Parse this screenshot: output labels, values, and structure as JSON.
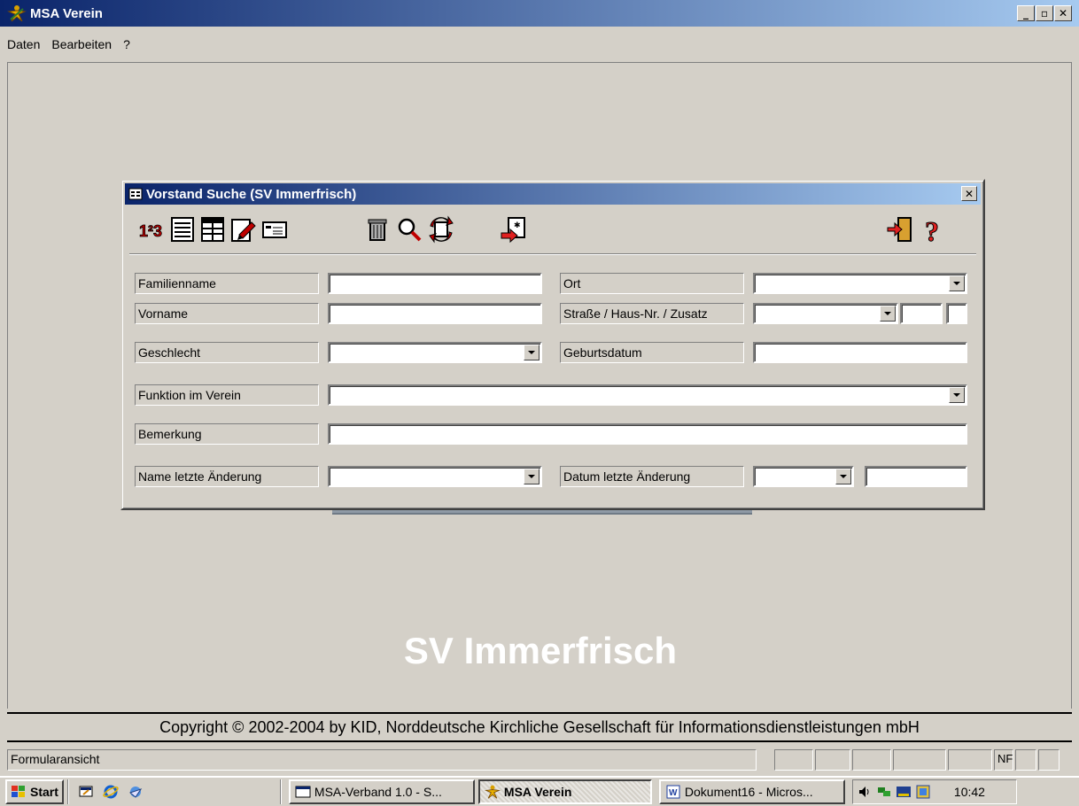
{
  "window": {
    "title": "MSA Verein"
  },
  "menu": [
    "Daten",
    "Bearbeiten",
    "?"
  ],
  "background": {
    "watermark": "SV Immerfrisch"
  },
  "copyright": "Copyright © 2002-2004 by KID, Norddeutsche Kirchliche Gesellschaft für Informationsdienstleistungen mbH",
  "status": {
    "text": "Formularansicht",
    "indicator": "NF"
  },
  "taskbar": {
    "start_label": "Start",
    "tasks": [
      "MSA-Verband 1.0 - S...",
      "MSA Verein",
      "Dokument16 - Micros..."
    ],
    "clock": "10:42"
  },
  "dialog": {
    "title": "Vorstand Suche (SV Immerfrisch)",
    "toolbar": [
      "numbers-icon",
      "list-icon",
      "table-icon",
      "edit-icon",
      "card-icon",
      "trash-icon",
      "search-icon",
      "refresh-icon",
      "export-icon",
      "exit-icon",
      "help-icon"
    ],
    "fields": {
      "familienname": {
        "label": "Familienname",
        "value": ""
      },
      "vorname": {
        "label": "Vorname",
        "value": ""
      },
      "geschlecht": {
        "label": "Geschlecht",
        "value": ""
      },
      "funktion": {
        "label": "Funktion im Verein",
        "value": ""
      },
      "bemerkung": {
        "label": "Bemerkung",
        "value": ""
      },
      "name_aenderung": {
        "label": "Name letzte Änderung",
        "value": ""
      },
      "ort": {
        "label": "Ort",
        "value": ""
      },
      "strasse": {
        "label": "Straße / Haus-Nr. / Zusatz",
        "value": ""
      },
      "geburtsdatum": {
        "label": "Geburtsdatum",
        "value": ""
      },
      "datum_aenderung": {
        "label": "Datum letzte Änderung",
        "value": ""
      }
    }
  }
}
